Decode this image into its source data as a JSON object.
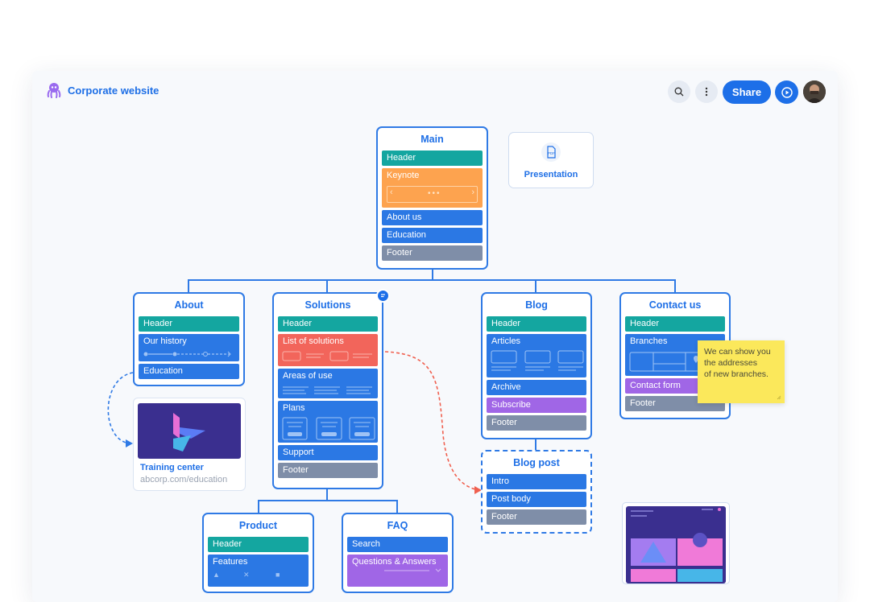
{
  "app": {
    "title": "Corporate website"
  },
  "toolbar": {
    "share_label": "Share"
  },
  "presentation": {
    "label": "Presentation",
    "icon_text": "PDF"
  },
  "main": {
    "title": "Main",
    "rows": [
      "Header",
      "Keynote",
      "About us",
      "Education",
      "Footer"
    ]
  },
  "about": {
    "title": "About",
    "rows": [
      "Header",
      "Our history",
      "Education"
    ]
  },
  "solutions": {
    "title": "Solutions",
    "rows": [
      "Header",
      "List of solutions",
      "Areas of use",
      "Plans",
      "Support",
      "Footer"
    ]
  },
  "blog": {
    "title": "Blog",
    "rows": [
      "Header",
      "Articles",
      "Archive",
      "Subscribe",
      "Footer"
    ]
  },
  "contact": {
    "title": "Contact us",
    "rows": [
      "Header",
      "Branches",
      "Contact form",
      "Footer"
    ]
  },
  "blogpost": {
    "title": "Blog post",
    "rows": [
      "Intro",
      "Post body",
      "Footer"
    ]
  },
  "product": {
    "title": "Product",
    "rows": [
      "Header",
      "Features"
    ]
  },
  "faq": {
    "title": "FAQ",
    "rows": [
      "Search",
      "Questions & Answers"
    ]
  },
  "training": {
    "title": "Training center",
    "url": "abcorp.com/education"
  },
  "note": {
    "line1": "We can show you",
    "line2": "the addresses",
    "line3": "of new branches."
  },
  "colors": {
    "accent": "#1d6fe8",
    "teal": "#14a6a0",
    "blue": "#2b78e4",
    "orange": "#fda34f",
    "red": "#f2655b",
    "purple": "#a066e6",
    "gray": "#7f8ea8",
    "note": "#fbe85b"
  }
}
